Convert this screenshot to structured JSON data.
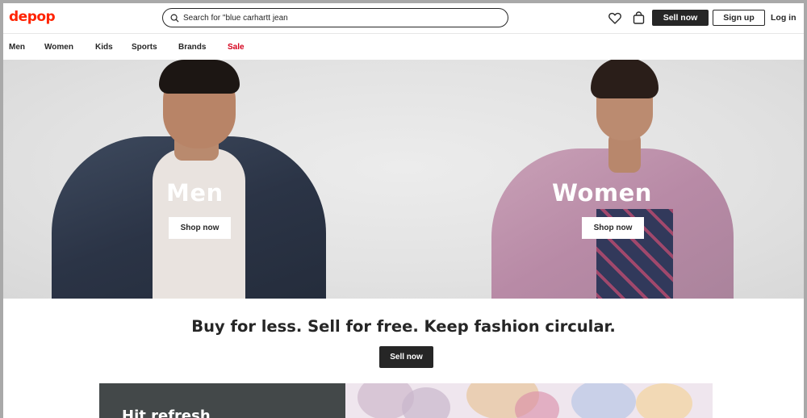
{
  "header": {
    "logo": "depop",
    "search_value": "Search for \"blue carhartt jean",
    "sell_label": "Sell now",
    "signup_label": "Sign up",
    "login_label": "Log in"
  },
  "nav": {
    "items": [
      "Men",
      "Women",
      "Kids",
      "Sports",
      "Brands",
      "Sale"
    ]
  },
  "hero": {
    "men_title": "Men",
    "women_title": "Women",
    "shop_label": "Shop now"
  },
  "tagline": "Buy for less. Sell for free. Keep fashion circular.",
  "cta_sell_label": "Sell now",
  "promo_title": "Hit refresh",
  "colors": {
    "brand": "#ff2300",
    "sale": "#d5001c",
    "dark": "#262626"
  }
}
